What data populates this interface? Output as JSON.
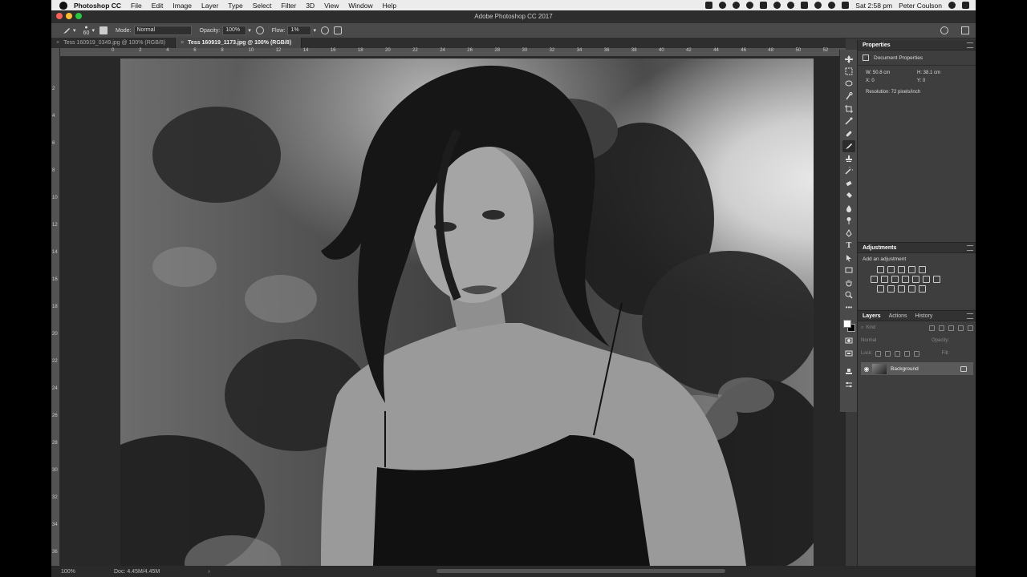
{
  "menubar": {
    "app_name": "Photoshop CC",
    "items": [
      "File",
      "Edit",
      "Image",
      "Layer",
      "Type",
      "Select",
      "Filter",
      "3D",
      "View",
      "Window",
      "Help"
    ],
    "clock": "Sat 2:58 pm",
    "user": "Peter Coulson"
  },
  "window": {
    "title": "Adobe Photoshop CC 2017"
  },
  "options": {
    "brush_size": "60",
    "mode_label": "Mode:",
    "mode_value": "Normal",
    "opacity_label": "Opacity:",
    "opacity_value": "100%",
    "flow_label": "Flow:",
    "flow_value": "1%"
  },
  "tabs": [
    {
      "label": "Tess 160919_0349.jpg @ 100% (RGB/8)",
      "active": false
    },
    {
      "label": "Tess 160919_1173.jpg @ 100% (RGB/8)",
      "active": true
    }
  ],
  "ruler": {
    "h_ticks": [
      "0",
      "2",
      "4",
      "6",
      "8",
      "10",
      "12",
      "14",
      "16",
      "18",
      "20",
      "22",
      "24",
      "26",
      "28",
      "30",
      "32",
      "34",
      "36",
      "38",
      "40",
      "42",
      "44",
      "46",
      "48",
      "50",
      "52"
    ],
    "v_ticks": [
      "2",
      "4",
      "6",
      "8",
      "10",
      "12",
      "14",
      "16",
      "18",
      "20",
      "22",
      "24",
      "26",
      "28",
      "30",
      "32",
      "34",
      "36"
    ]
  },
  "properties": {
    "tab": "Properties",
    "subtitle": "Document Properties",
    "w": "W: 50.8 cm",
    "h": "H: 38.1 cm",
    "x": "X: 0",
    "y": "Y: 0",
    "resolution": "Resolution: 72 pixels/inch"
  },
  "adjustments": {
    "tab": "Adjustments",
    "label": "Add an adjustment"
  },
  "layers": {
    "tabs": [
      "Layers",
      "Actions",
      "History"
    ],
    "filter_placeholder": "Kind",
    "blend_mode": "Normal",
    "opacity_label": "Opacity:",
    "lock_label": "Lock:",
    "fill_label": "Fill:",
    "items": [
      {
        "name": "Background"
      }
    ]
  },
  "status": {
    "zoom": "100%",
    "doc": "Doc: 4.45M/4.45M"
  },
  "colors": {
    "accent": "#3a3a3a",
    "traffic": [
      "#fc5f57",
      "#fdbc2e",
      "#28c840"
    ]
  }
}
